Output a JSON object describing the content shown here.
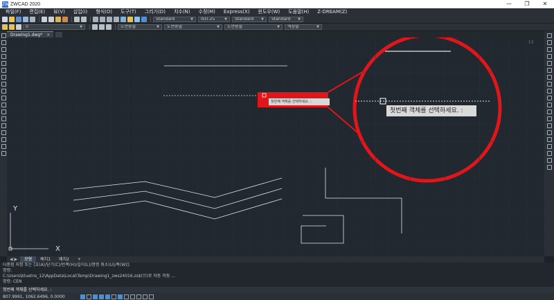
{
  "window": {
    "title": "ZWCAD 2020",
    "app_icon": "ZW",
    "minimize": "—",
    "restore": "❐",
    "close": "✕"
  },
  "menu": [
    "파일(F)",
    "편집(E)",
    "뷰(V)",
    "삽입(I)",
    "형식(O)",
    "도구(T)",
    "그리기(D)",
    "치수(N)",
    "수정(M)",
    "Express(X)",
    "윈도우(W)",
    "도움말(H)",
    "Z-DREAM(Z)"
  ],
  "toolbar": {
    "text_style": "Standard",
    "dim_style": "ISO-25",
    "table_style": "Standard",
    "multileader_style": "Standard",
    "layer": "0",
    "color": "도면층별",
    "linetype": "도면층별",
    "lineweight": "도면층별",
    "plot_style": "색상별"
  },
  "doc_tab": {
    "name": "Drawing1.dwg*",
    "close": "×"
  },
  "viewport_label": "[-]",
  "tooltip": {
    "small": "첫번째 객체를 선택하세요. :",
    "large": "첫번째 객체를 선택하세요. :"
  },
  "ucs": {
    "y": "Y",
    "x": "X"
  },
  "layout_tabs": [
    "모형",
    "배치1",
    "배치2",
    "+"
  ],
  "command_history": [
    "다중점 지정 또는 [호(A)/닫기(C)/반폭(H)/길이(L)/명령 취소(U)/폭(W)]:",
    "명령:",
    "C:\\Users\\bluetns_12\\AppData\\Local\\Temp\\Drawing1_zws24016.zs$(으)로 자동 저장 ...",
    "명령: CEN"
  ],
  "command_prompt": "첫번째 객체를 선택하세요. :",
  "status": {
    "coords": "807.9991, 1062.6496, 0.0000"
  },
  "colors": {
    "canvas": "#212830",
    "highlight_red": "#e0161b",
    "ui_dark": "#2b3036"
  }
}
